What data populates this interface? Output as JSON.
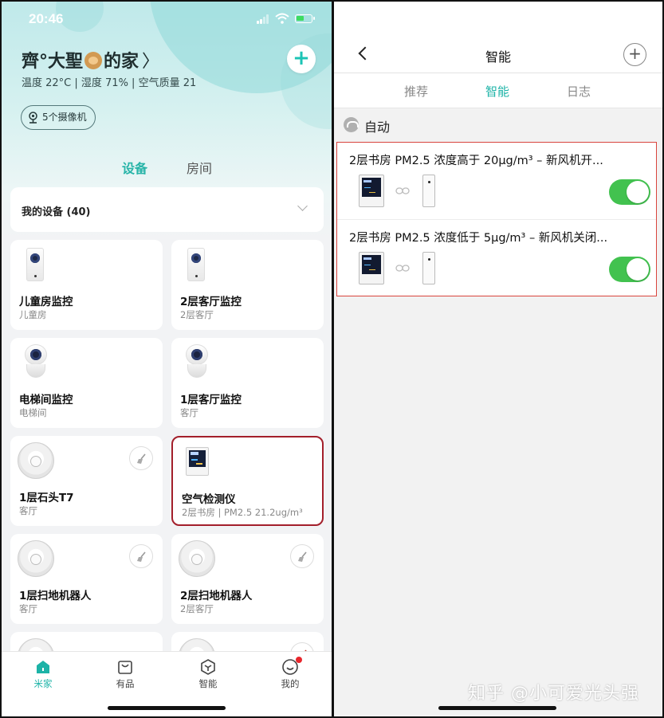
{
  "left": {
    "status_time": "20:46",
    "home": {
      "title_prefix": "齊°大聖",
      "title_suffix": "的家",
      "chevron": "〉",
      "summary": "温度 22°C | 湿度 71% | 空气质量 21",
      "add_symbol": "+"
    },
    "camera_chip": "5个摄像机",
    "segments": {
      "devices": "设备",
      "rooms": "房间"
    },
    "my_devices": "我的设备 (40)",
    "devices": [
      {
        "name": "儿童房监控",
        "room": "儿童房",
        "icon": "camera-cube-icon"
      },
      {
        "name": "2层客厅监控",
        "room": "2层客厅",
        "icon": "camera-cube-icon"
      },
      {
        "name": "电梯间监控",
        "room": "电梯间",
        "icon": "camera-ptz-icon"
      },
      {
        "name": "1层客厅监控",
        "room": "客厅",
        "icon": "camera-ptz-icon"
      },
      {
        "name": "1层石头T7",
        "room": "客厅",
        "icon": "robot-vacuum-icon",
        "action": "sweep-icon"
      },
      {
        "name": "空气检测仪",
        "room": "2层书房 | PM2.5 21.2ug/m³",
        "icon": "air-monitor-icon",
        "highlight": true
      },
      {
        "name": "1层扫地机器人",
        "room": "客厅",
        "icon": "robot-vacuum-icon",
        "action": "sweep-icon"
      },
      {
        "name": "2层扫地机器人",
        "room": "2层客厅",
        "icon": "robot-vacuum-icon",
        "action": "sweep-icon"
      }
    ],
    "tabs": [
      {
        "label": "米家",
        "icon": "home-icon",
        "active": true
      },
      {
        "label": "有品",
        "icon": "shop-bag-icon"
      },
      {
        "label": "智能",
        "icon": "cube-icon"
      },
      {
        "label": "我的",
        "icon": "profile-icon",
        "badge": true
      }
    ]
  },
  "right": {
    "title": "智能",
    "add_symbol": "+",
    "tabs": [
      {
        "label": "推荐"
      },
      {
        "label": "智能",
        "active": true
      },
      {
        "label": "日志"
      }
    ],
    "section_title": "自动",
    "scenes": [
      {
        "title": "2层书房 PM2.5 浓度高于 20µg/m³ – 新风机开...",
        "enabled": true
      },
      {
        "title": "2层书房 PM2.5 浓度低于 5µg/m³ – 新风机关闭...",
        "enabled": true
      }
    ],
    "watermark": "知乎 @小可爱光头强"
  },
  "colors": {
    "accent": "#1cb3a7",
    "highlight_border": "#a31f2b",
    "annotation_border": "#d9443d",
    "toggle_on": "#42c24f",
    "badge_red": "#e8262c"
  }
}
